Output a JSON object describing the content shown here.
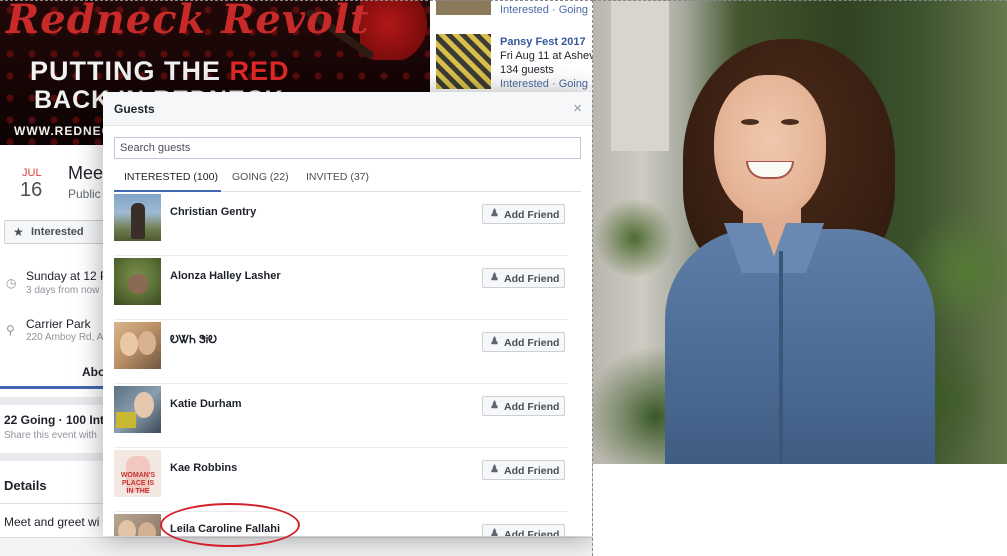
{
  "cover": {
    "script_text": "Redneck Revolt",
    "line1_prefix": "PUTTING THE ",
    "line1_red": "RED",
    "line2": "BACK IN REDNECK",
    "url": "WWW.REDNEC"
  },
  "related_events": [
    {
      "title": "",
      "subtitle": "",
      "actions": "Interested · Going"
    },
    {
      "title": "Pansy Fest 2017",
      "subtitle": "Fri Aug 11 at Ashevil",
      "count": "134 guests",
      "actions": "Interested · Going"
    }
  ],
  "event": {
    "month": "JUL",
    "day": "16",
    "title": "Meet",
    "privacy": "Public",
    "interested_label": "Interested",
    "time_main": "Sunday at 12 P",
    "time_sub": "3 days from now",
    "place_main": "Carrier Park",
    "place_sub": "220 Amboy Rd, A",
    "about_tab": "Abo",
    "going_summary": "22 Going · 100 Int",
    "share_text": "Share this event with",
    "details_head": "Details",
    "details_text": "Meet and greet wi"
  },
  "modal": {
    "title": "Guests",
    "close_glyph": "×",
    "search_placeholder": "Search guests",
    "tabs": [
      {
        "label": "INTERESTED (100)",
        "active": true
      },
      {
        "label": "GOING (22)",
        "active": false
      },
      {
        "label": "INVITED (37)",
        "active": false
      }
    ],
    "add_friend_label": "Add Friend",
    "guests": [
      {
        "name": "Christian Gentry"
      },
      {
        "name": "Alonza Halley Lasher"
      },
      {
        "name": "ᎧᏔᏂ ᏕᎥᎧ"
      },
      {
        "name": "Katie Durham"
      },
      {
        "name": "Kae Robbins"
      },
      {
        "name": "Leila Caroline Fallahi"
      }
    ],
    "avatar5_text": "WOMAN'S PLACE IS IN THE"
  },
  "colors": {
    "accent": "#4267b2",
    "link": "#365899",
    "annotation": "#d4202a"
  },
  "icons": {
    "close": "close-icon",
    "star": "star-icon",
    "clock": "clock-icon",
    "pin": "location-pin-icon",
    "add_friend": "add-friend-icon"
  }
}
